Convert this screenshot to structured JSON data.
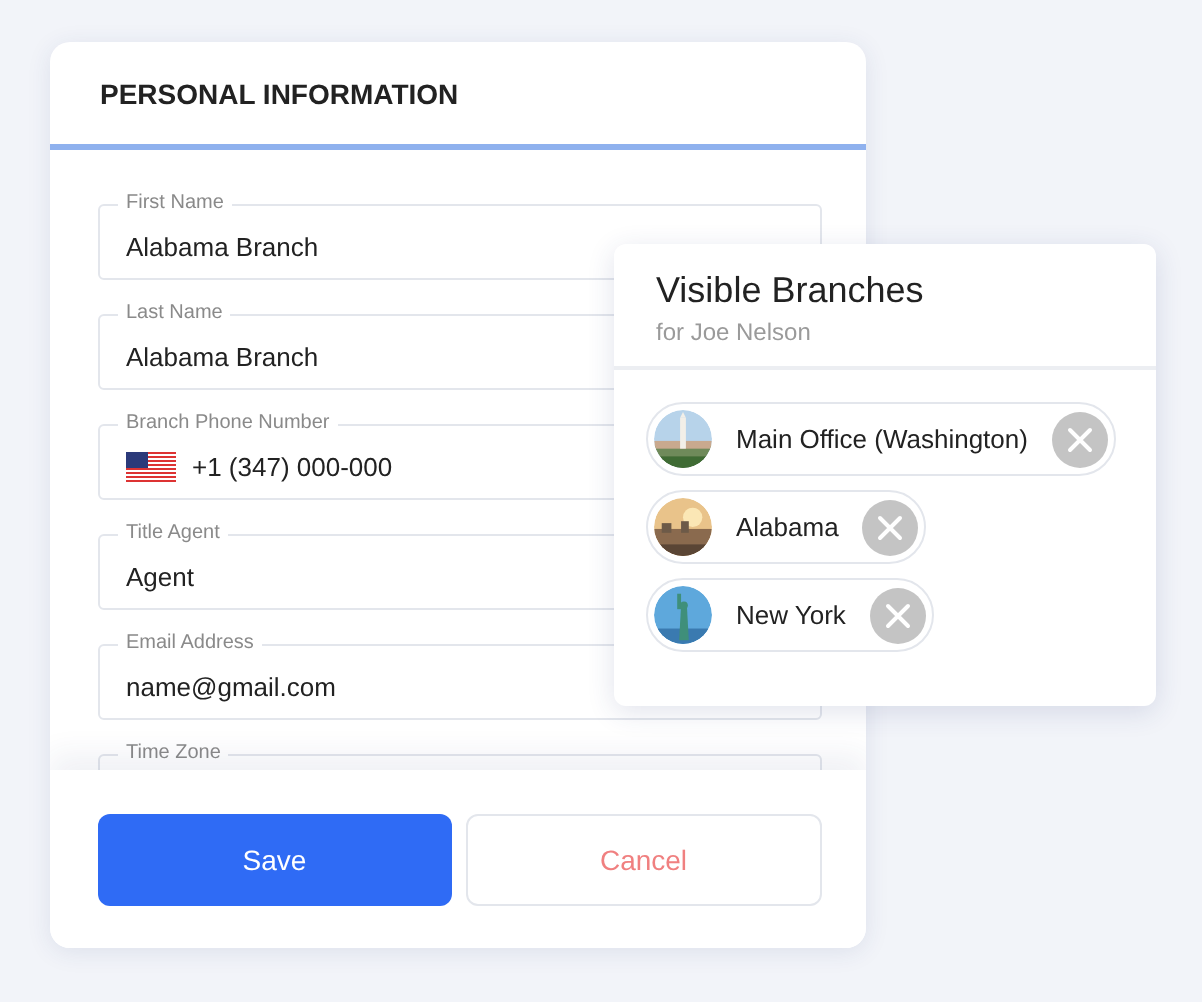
{
  "form": {
    "title": "PERSONAL INFORMATION",
    "fields": [
      {
        "label": "First Name",
        "value": "Alabama Branch",
        "kind": "text"
      },
      {
        "label": "Last Name",
        "value": "Alabama Branch",
        "kind": "text"
      },
      {
        "label": "Branch Phone Number",
        "value": "+1 (347) 000-000",
        "kind": "phone"
      },
      {
        "label": "Title Agent",
        "value": "Agent",
        "kind": "text"
      },
      {
        "label": "Email Address",
        "value": "name@gmail.com",
        "kind": "text"
      },
      {
        "label": "Time Zone",
        "kind": "text"
      }
    ],
    "buttons": [
      {
        "label": "Save",
        "kind": "primary"
      },
      {
        "label": "Cancel",
        "kind": "secondary"
      }
    ]
  },
  "popup": {
    "title": "Visible Branches",
    "subtitle": "for Joe Nelson",
    "branches": [
      {
        "name": "Main Office (Washington)",
        "kind": "picture"
      },
      {
        "name": "Alabama",
        "kind": "picture"
      },
      {
        "name": "New York",
        "kind": "picture"
      }
    ]
  }
}
